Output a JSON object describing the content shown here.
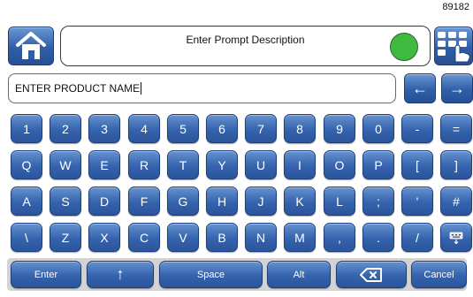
{
  "corner_id": "89182",
  "prompt": {
    "label": "Enter Prompt Description",
    "status_color": "#3fb93f"
  },
  "entry": {
    "value": "ENTER PRODUCT NAME"
  },
  "nav": {
    "left_arrow": "←",
    "right_arrow": "→"
  },
  "rows": [
    [
      "1",
      "2",
      "3",
      "4",
      "5",
      "6",
      "7",
      "8",
      "9",
      "0",
      "-",
      "="
    ],
    [
      "Q",
      "W",
      "E",
      "R",
      "T",
      "Y",
      "U",
      "I",
      "O",
      "P",
      "[",
      "]"
    ],
    [
      "A",
      "S",
      "D",
      "F",
      "G",
      "H",
      "J",
      "K",
      "L",
      ";",
      "'",
      "#"
    ],
    [
      "\\",
      "Z",
      "X",
      "C",
      "V",
      "B",
      "N",
      "M",
      ",",
      ".",
      "/"
    ]
  ],
  "bottom": {
    "enter": "Enter",
    "shift_icon": "↑",
    "space": "Space",
    "alt": "Alt",
    "backspace_icon": "backspace",
    "cancel": "Cancel"
  },
  "icons": {
    "home": "home-icon",
    "keyboard_select": "keyboard-select-icon",
    "small_keyboard": "small-keyboard-icon"
  }
}
